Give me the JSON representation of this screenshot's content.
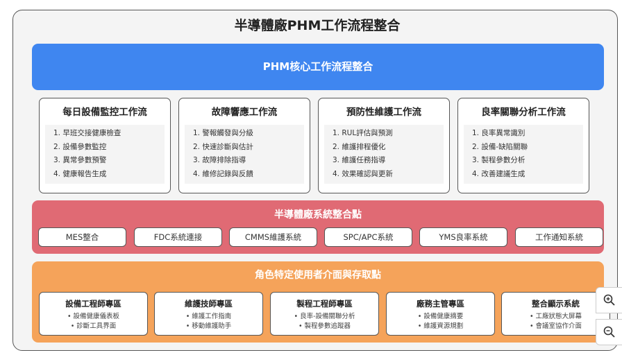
{
  "title": "半導體廠PHM工作流程整合",
  "core": {
    "title": "PHM核心工作流程整合"
  },
  "workflows": [
    {
      "title": "每日設備監控工作流",
      "items": [
        "1. 早班交接健康檢查",
        "2. 設備參數監控",
        "3. 異常參數預警",
        "4. 健康報告生成"
      ]
    },
    {
      "title": "故障響應工作流",
      "items": [
        "1. 警報觸發與分級",
        "2. 快速診斷與估計",
        "3. 故障排除指導",
        "4. 維修記錄與反饋"
      ]
    },
    {
      "title": "預防性維護工作流",
      "items": [
        "1. RUL評估與預測",
        "2. 維護排程優化",
        "3. 維護任務指導",
        "4. 效果確認與更新"
      ]
    },
    {
      "title": "良率關聯分析工作流",
      "items": [
        "1. 良率異常識別",
        "2. 設備-缺陷關聯",
        "3. 製程參數分析",
        "4. 改善建議生成"
      ]
    }
  ],
  "systems": {
    "title": "半導體廠系統整合點",
    "items": [
      "MES整合",
      "FDC系統連接",
      "CMMS維護系統",
      "SPC/APC系統",
      "YMS良率系統",
      "工作通知系統"
    ]
  },
  "roles": {
    "title": "角色特定使用者介面與存取點",
    "cards": [
      {
        "title": "設備工程師專區",
        "items": [
          "• 設備健康儀表板",
          "• 診斷工具界面"
        ]
      },
      {
        "title": "維護技師專區",
        "items": [
          "• 維護工作指南",
          "• 移動維護助手"
        ]
      },
      {
        "title": "製程工程師專區",
        "items": [
          "• 良率-設備關聯分析",
          "• 製程參數追蹤器"
        ]
      },
      {
        "title": "廠務主管專區",
        "items": [
          "• 設備健康摘要",
          "• 維護資源規劃"
        ]
      },
      {
        "title": "整合顯示系統",
        "items": [
          "• 工廠狀態大屏幕",
          "• 會議室協作介面"
        ]
      }
    ]
  },
  "zoom_controls": {
    "zoom_in": "zoom-in-icon",
    "zoom_out": "zoom-out-icon"
  }
}
